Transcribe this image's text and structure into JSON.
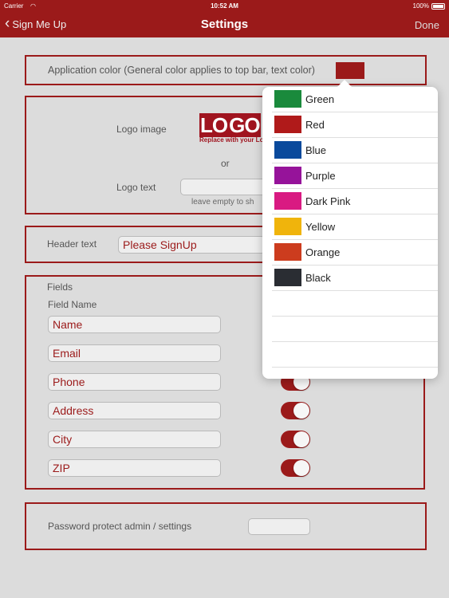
{
  "status_bar": {
    "carrier": "Carrier",
    "time": "10:52 AM",
    "battery": "100%"
  },
  "nav": {
    "back_label": "Sign Me Up",
    "title": "Settings",
    "done_label": "Done"
  },
  "app_color": {
    "label": "Application color (General color applies to top bar, text color)",
    "value_color": "#9b1a1a"
  },
  "logo": {
    "image_label": "Logo image",
    "logo_text_part1": "LO",
    "logo_text_part2": "GO",
    "logo_caption": "Replace with your Lo",
    "or_label": "or",
    "text_label": "Logo text",
    "text_value": "",
    "hint": "leave empty to sh"
  },
  "header": {
    "label": "Header text",
    "value": "Please SignUp"
  },
  "fields": {
    "section_label": "Fields",
    "column_label": "Field Name",
    "items": [
      {
        "name": "Name",
        "enabled": true
      },
      {
        "name": "Email",
        "enabled": true
      },
      {
        "name": "Phone",
        "enabled": true
      },
      {
        "name": "Address",
        "enabled": true
      },
      {
        "name": "City",
        "enabled": true
      },
      {
        "name": "ZIP",
        "enabled": true
      }
    ]
  },
  "password": {
    "label": "Password protect admin / settings",
    "value": ""
  },
  "color_picker": {
    "options": [
      {
        "name": "Green",
        "color": "#1a8a3c"
      },
      {
        "name": "Red",
        "color": "#b01a1a"
      },
      {
        "name": "Blue",
        "color": "#0a4a9c"
      },
      {
        "name": "Purple",
        "color": "#96139a"
      },
      {
        "name": "Dark Pink",
        "color": "#d91a82"
      },
      {
        "name": "Yellow",
        "color": "#f0b40c"
      },
      {
        "name": "Orange",
        "color": "#cc3c1e"
      },
      {
        "name": "Black",
        "color": "#2a2d33"
      }
    ]
  }
}
